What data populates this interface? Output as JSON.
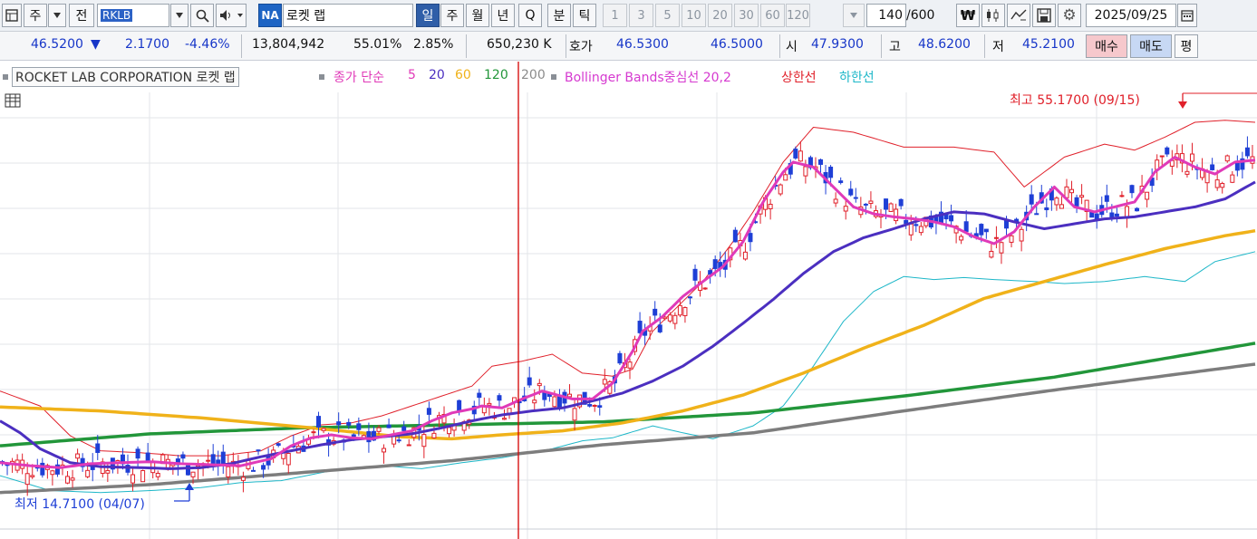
{
  "toolbar": {
    "market_type": "주",
    "prev_label": "전",
    "symbol": "RKLB",
    "na_badge": "NA",
    "stock_name": "로켓 랩",
    "period_tabs": [
      {
        "label": "일",
        "selected": true
      },
      {
        "label": "주",
        "selected": false
      },
      {
        "label": "월",
        "selected": false
      },
      {
        "label": "년",
        "selected": false
      },
      {
        "label": "Q",
        "selected": false
      },
      {
        "label": "분",
        "selected": false
      },
      {
        "label": "틱",
        "selected": false
      }
    ],
    "interval_tabs": [
      "1",
      "3",
      "5",
      "10",
      "20",
      "30",
      "60",
      "120"
    ],
    "count": "140",
    "count_total": "/600",
    "date": "2025/09/25"
  },
  "quote": {
    "price": "46.5200",
    "direction": "▼",
    "change": "2.1700",
    "change_pct": "-4.46%",
    "volume": "13,804,942",
    "vol_ratio": "55.01%",
    "turnover": "2.85%",
    "amount": "650,230 K",
    "bidask_label": "호가",
    "ask": "46.5300",
    "bid": "46.5000",
    "open_label": "시",
    "open": "47.9300",
    "high_label": "고",
    "high": "48.6200",
    "low_label": "저",
    "low": "45.2100",
    "buy_label": "매수",
    "sell_label": "매도",
    "flat_label": "평"
  },
  "legend": {
    "company": "ROCKET LAB CORPORATION  로켓 랩",
    "ma_prefix": "종가 단순",
    "ma5": "5",
    "ma20": "20",
    "ma60": "60",
    "ma120": "120",
    "ma200": "200",
    "bb_label": "Bollinger Bands중심선 20,2",
    "bb_upper": "상한선",
    "bb_lower": "하한선"
  },
  "annotations": {
    "high_note": "최고 55.1700 (09/15)",
    "low_note": "최저 14.7100 (04/07)"
  },
  "colors": {
    "up": "#e0202a",
    "down": "#1e3fd6",
    "ma5": "#e03ab8",
    "ma20": "#4b2fc0",
    "ma60": "#f0b21a",
    "ma120": "#22963a",
    "ma200": "#7d7d7d",
    "bb_upper": "#e0202a",
    "bb_lower": "#1db7c8",
    "bb_mid": "#d63ad0",
    "crosshair": "#d40000"
  },
  "chart_data": {
    "type": "line",
    "title": "ROCKET LAB CORPORATION  로켓 랩",
    "period": "daily",
    "bars": 140,
    "y_range": [
      13.5,
      57.0
    ],
    "highest": {
      "value": 55.17,
      "date": "09/15"
    },
    "lowest": {
      "value": 14.71,
      "date": "04/07"
    },
    "last_ohlc": {
      "open": 47.93,
      "high": 48.62,
      "low": 45.21,
      "close": 46.52
    },
    "series": [
      {
        "name": "5",
        "key": "ma5",
        "values": [
          [
            0,
            19.8
          ],
          [
            6,
            19.5
          ],
          [
            12,
            19.3
          ],
          [
            18,
            19.7
          ],
          [
            24,
            19.8
          ],
          [
            30,
            19.9
          ],
          [
            36,
            19.7
          ],
          [
            42,
            19.6
          ],
          [
            48,
            19.5
          ],
          [
            54,
            20.2
          ],
          [
            58,
            21.5
          ],
          [
            62,
            22.3
          ],
          [
            66,
            22.6
          ],
          [
            70,
            22.3
          ],
          [
            74,
            22.2
          ],
          [
            78,
            22.6
          ],
          [
            82,
            23.0
          ],
          [
            86,
            24.0
          ],
          [
            90,
            24.8
          ],
          [
            94,
            25.2
          ],
          [
            96,
            25.5
          ],
          [
            100,
            25.3
          ],
          [
            104,
            26.2
          ],
          [
            108,
            27.0
          ],
          [
            111,
            26.6
          ],
          [
            114,
            26.2
          ],
          [
            118,
            26.2
          ],
          [
            122,
            27.8
          ],
          [
            126,
            31.0
          ],
          [
            128,
            33.0
          ],
          [
            132,
            34.5
          ],
          [
            136,
            36.5
          ],
          [
            140,
            38.0
          ],
          [
            144,
            39.5
          ],
          [
            148,
            42.0
          ],
          [
            152,
            46.0
          ],
          [
            156,
            49.0
          ],
          [
            158,
            50.0
          ],
          [
            162,
            49.5
          ],
          [
            166,
            47.5
          ],
          [
            170,
            45.5
          ],
          [
            174,
            44.8
          ],
          [
            178,
            44.5
          ],
          [
            182,
            44.3
          ],
          [
            186,
            44.0
          ],
          [
            190,
            43.5
          ],
          [
            194,
            42.5
          ],
          [
            198,
            41.8
          ],
          [
            202,
            43.0
          ],
          [
            206,
            45.5
          ],
          [
            210,
            47.5
          ],
          [
            214,
            45.5
          ],
          [
            218,
            45.0
          ],
          [
            222,
            45.5
          ],
          [
            226,
            46.0
          ],
          [
            230,
            49.0
          ],
          [
            234,
            50.5
          ],
          [
            238,
            49.5
          ],
          [
            242,
            48.8
          ],
          [
            246,
            50.0
          ],
          [
            250,
            50.2
          ]
        ]
      },
      {
        "name": "20",
        "key": "ma20",
        "values": [
          [
            0,
            24.0
          ],
          [
            4,
            22.8
          ],
          [
            8,
            21.2
          ],
          [
            14,
            19.8
          ],
          [
            20,
            19.4
          ],
          [
            28,
            19.3
          ],
          [
            34,
            19.2
          ],
          [
            40,
            19.3
          ],
          [
            46,
            19.7
          ],
          [
            52,
            20.4
          ],
          [
            58,
            21.0
          ],
          [
            64,
            21.6
          ],
          [
            70,
            22.1
          ],
          [
            76,
            22.4
          ],
          [
            82,
            22.7
          ],
          [
            88,
            23.3
          ],
          [
            94,
            24.0
          ],
          [
            100,
            24.6
          ],
          [
            106,
            25.0
          ],
          [
            112,
            25.3
          ],
          [
            118,
            26.0
          ],
          [
            124,
            26.8
          ],
          [
            130,
            28.0
          ],
          [
            136,
            29.5
          ],
          [
            142,
            31.5
          ],
          [
            148,
            33.8
          ],
          [
            154,
            36.2
          ],
          [
            160,
            38.8
          ],
          [
            166,
            41.0
          ],
          [
            172,
            42.4
          ],
          [
            178,
            43.3
          ],
          [
            184,
            44.3
          ],
          [
            190,
            45.0
          ],
          [
            196,
            44.8
          ],
          [
            202,
            44.0
          ],
          [
            208,
            43.3
          ],
          [
            214,
            43.8
          ],
          [
            220,
            44.3
          ],
          [
            226,
            44.5
          ],
          [
            232,
            45.0
          ],
          [
            238,
            45.5
          ],
          [
            244,
            46.3
          ],
          [
            250,
            48.0
          ]
        ]
      },
      {
        "name": "60",
        "key": "ma60",
        "values": [
          [
            0,
            25.4
          ],
          [
            20,
            25.0
          ],
          [
            40,
            24.3
          ],
          [
            60,
            23.4
          ],
          [
            80,
            22.4
          ],
          [
            90,
            22.2
          ],
          [
            100,
            22.6
          ],
          [
            112,
            23.0
          ],
          [
            124,
            23.8
          ],
          [
            136,
            25.0
          ],
          [
            148,
            26.6
          ],
          [
            160,
            28.8
          ],
          [
            172,
            31.3
          ],
          [
            184,
            33.6
          ],
          [
            196,
            36.3
          ],
          [
            208,
            38.0
          ],
          [
            220,
            39.7
          ],
          [
            232,
            41.3
          ],
          [
            244,
            42.6
          ],
          [
            250,
            43.1
          ]
        ]
      },
      {
        "name": "120",
        "key": "ma120",
        "values": [
          [
            0,
            21.5
          ],
          [
            30,
            22.7
          ],
          [
            60,
            23.3
          ],
          [
            90,
            23.6
          ],
          [
            120,
            23.9
          ],
          [
            150,
            24.8
          ],
          [
            180,
            26.5
          ],
          [
            210,
            28.4
          ],
          [
            230,
            30.1
          ],
          [
            250,
            31.8
          ]
        ]
      },
      {
        "name": "200",
        "key": "ma200",
        "values": [
          [
            0,
            16.8
          ],
          [
            30,
            17.6
          ],
          [
            60,
            18.8
          ],
          [
            90,
            20.0
          ],
          [
            120,
            21.6
          ],
          [
            150,
            22.8
          ],
          [
            180,
            25.0
          ],
          [
            210,
            27.1
          ],
          [
            230,
            28.4
          ],
          [
            250,
            29.7
          ]
        ]
      }
    ],
    "bollinger": {
      "upper": [
        [
          0,
          27.0
        ],
        [
          8,
          25.5
        ],
        [
          14,
          22.5
        ],
        [
          20,
          21.0
        ],
        [
          28,
          20.8
        ],
        [
          36,
          20.5
        ],
        [
          44,
          20.5
        ],
        [
          52,
          21.0
        ],
        [
          58,
          22.5
        ],
        [
          64,
          23.6
        ],
        [
          70,
          23.8
        ],
        [
          76,
          24.5
        ],
        [
          82,
          25.5
        ],
        [
          88,
          26.5
        ],
        [
          94,
          27.5
        ],
        [
          98,
          29.5
        ],
        [
          104,
          30.0
        ],
        [
          110,
          30.7
        ],
        [
          116,
          28.8
        ],
        [
          122,
          28.5
        ],
        [
          126,
          29.2
        ],
        [
          130,
          33.0
        ],
        [
          134,
          35.0
        ],
        [
          140,
          38.0
        ],
        [
          146,
          42.0
        ],
        [
          150,
          45.0
        ],
        [
          156,
          50.0
        ],
        [
          162,
          53.5
        ],
        [
          170,
          53.0
        ],
        [
          180,
          51.5
        ],
        [
          190,
          51.5
        ],
        [
          198,
          51.0
        ],
        [
          204,
          47.5
        ],
        [
          212,
          50.5
        ],
        [
          220,
          51.8
        ],
        [
          226,
          51.2
        ],
        [
          232,
          52.5
        ],
        [
          238,
          54.0
        ],
        [
          244,
          54.2
        ],
        [
          250,
          54.0
        ]
      ],
      "lower": [
        [
          0,
          18.5
        ],
        [
          10,
          17.0
        ],
        [
          20,
          16.8
        ],
        [
          30,
          17.0
        ],
        [
          40,
          17.3
        ],
        [
          48,
          17.8
        ],
        [
          56,
          18.0
        ],
        [
          66,
          19.0
        ],
        [
          76,
          19.5
        ],
        [
          84,
          19.2
        ],
        [
          92,
          19.8
        ],
        [
          100,
          20.3
        ],
        [
          110,
          21.2
        ],
        [
          116,
          22.0
        ],
        [
          122,
          22.3
        ],
        [
          130,
          23.5
        ],
        [
          136,
          22.8
        ],
        [
          142,
          22.2
        ],
        [
          150,
          23.5
        ],
        [
          156,
          25.5
        ],
        [
          162,
          29.5
        ],
        [
          168,
          34.0
        ],
        [
          174,
          37.0
        ],
        [
          180,
          38.5
        ],
        [
          186,
          38.2
        ],
        [
          192,
          38.4
        ],
        [
          198,
          38.2
        ],
        [
          206,
          38.0
        ],
        [
          212,
          37.8
        ],
        [
          220,
          38.0
        ],
        [
          228,
          38.5
        ],
        [
          236,
          38.0
        ],
        [
          242,
          40.0
        ],
        [
          250,
          41.0
        ]
      ]
    }
  }
}
